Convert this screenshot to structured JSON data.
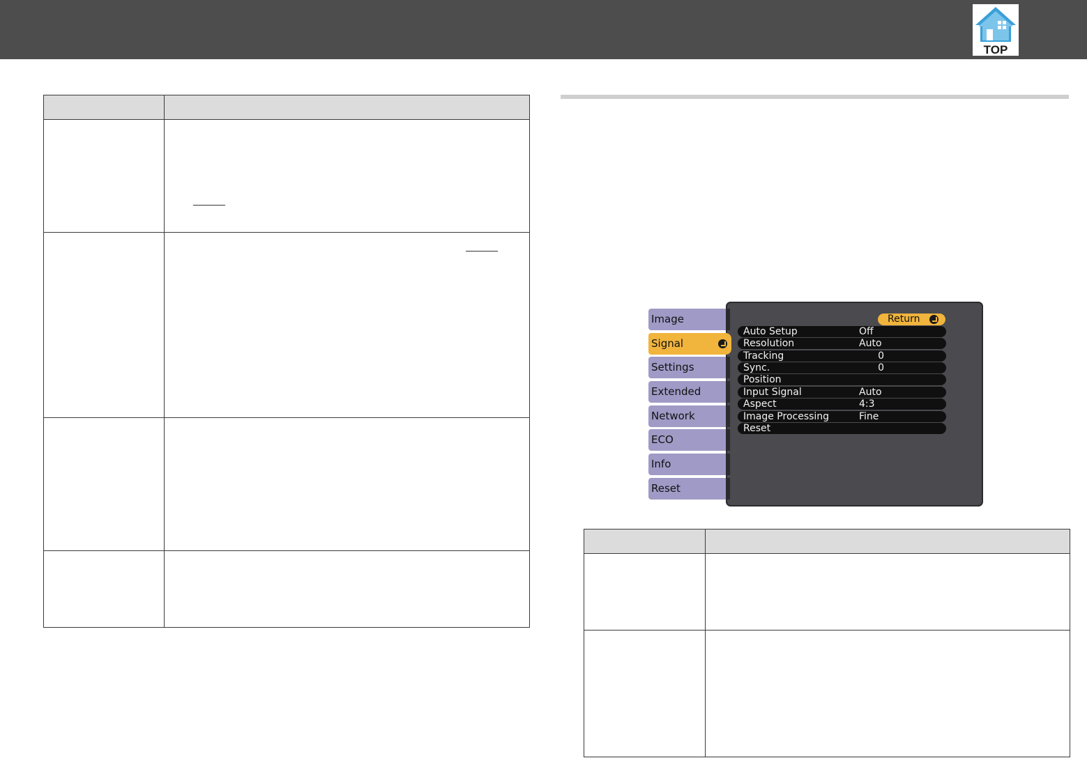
{
  "header": {
    "icon": "top-house-icon",
    "icon_label": "TOP",
    "colors": {
      "bar": "#4d4d4d",
      "icon": "#3aa0d8"
    }
  },
  "osd_menu": {
    "tabs": [
      "Image",
      "Signal",
      "Settings",
      "Extended",
      "Network",
      "ECO",
      "Info",
      "Reset"
    ],
    "active_tab": "Signal",
    "return_label": "Return",
    "rows": [
      {
        "label": "Auto Setup",
        "value": "Off"
      },
      {
        "label": "Resolution",
        "value": "Auto"
      },
      {
        "label": "Tracking",
        "value": "0"
      },
      {
        "label": "Sync.",
        "value": "0"
      },
      {
        "label": "Position",
        "value": ""
      },
      {
        "label": "Input Signal",
        "value": "Auto"
      },
      {
        "label": "Aspect",
        "value": "4:3"
      },
      {
        "label": "Image Processing",
        "value": "Fine"
      },
      {
        "label": "Reset",
        "value": ""
      }
    ],
    "colors": {
      "accent": "#f1b43c",
      "tab": "#9f9ac6",
      "panel": "#4a4a4f",
      "row": "#101010"
    }
  }
}
